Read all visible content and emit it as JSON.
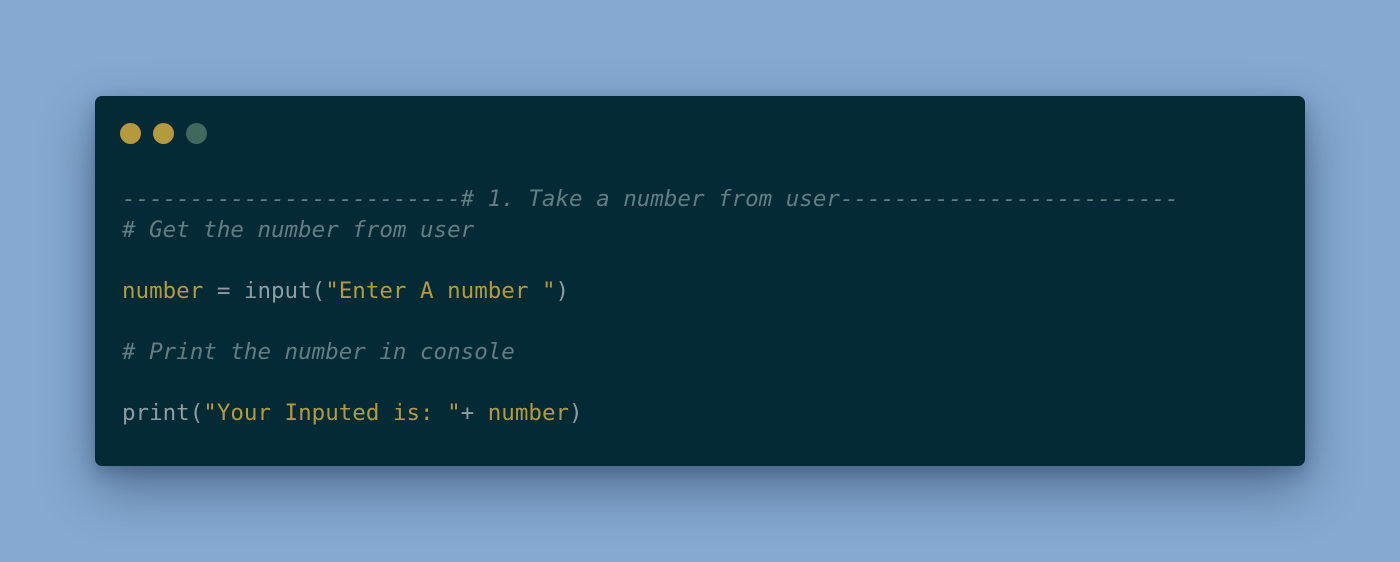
{
  "window": {
    "traffic_lights": [
      "close",
      "minimize",
      "maximize"
    ]
  },
  "code": {
    "line1_comment": "-------------------------# 1. Take a number from user-------------------------",
    "line2_comment": "# Get the number from user",
    "line4_var": "number",
    "line4_op": " = ",
    "line4_fn": "input(",
    "line4_str": "\"Enter A number \"",
    "line4_close": ")",
    "line6_comment": "# Print the number in console",
    "line8_fn": "print(",
    "line8_str": "\"Your Inputed is: \"",
    "line8_op": "+ ",
    "line8_var": "number",
    "line8_close": ")"
  },
  "colors": {
    "background": "#85a9d0",
    "window": "#032a35",
    "accent_yellow": "#b59a3d",
    "comment": "#627d84",
    "text": "#8d9ea3",
    "dot_green": "#40685c"
  }
}
